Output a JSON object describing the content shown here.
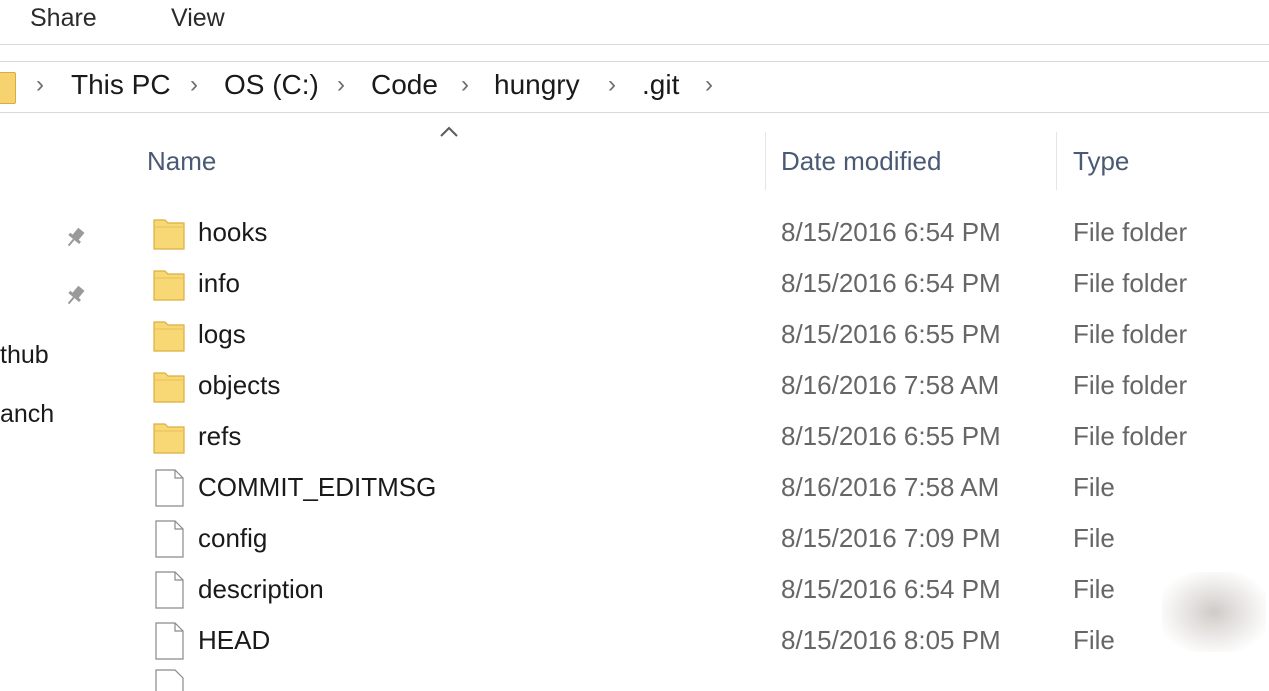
{
  "ribbon": {
    "tabs": [
      {
        "label": "Share"
      },
      {
        "label": "View"
      }
    ]
  },
  "address": {
    "crumbs": [
      "This PC",
      "OS (C:)",
      "Code",
      "hungry",
      ".git"
    ]
  },
  "nav": {
    "items": [
      {
        "label": "thub"
      },
      {
        "label": "anch"
      }
    ]
  },
  "columns": {
    "name": "Name",
    "date": "Date modified",
    "type": "Type"
  },
  "files": [
    {
      "name": "hooks",
      "date": "8/15/2016 6:54 PM",
      "type": "File folder",
      "icon": "folder-icon"
    },
    {
      "name": "info",
      "date": "8/15/2016 6:54 PM",
      "type": "File folder",
      "icon": "folder-icon"
    },
    {
      "name": "logs",
      "date": "8/15/2016 6:55 PM",
      "type": "File folder",
      "icon": "folder-icon"
    },
    {
      "name": "objects",
      "date": "8/16/2016 7:58 AM",
      "type": "File folder",
      "icon": "folder-icon"
    },
    {
      "name": "refs",
      "date": "8/15/2016 6:55 PM",
      "type": "File folder",
      "icon": "folder-icon"
    },
    {
      "name": "COMMIT_EDITMSG",
      "date": "8/16/2016 7:58 AM",
      "type": "File",
      "icon": "file-icon"
    },
    {
      "name": "config",
      "date": "8/15/2016 7:09 PM",
      "type": "File",
      "icon": "file-icon"
    },
    {
      "name": "description",
      "date": "8/15/2016 6:54 PM",
      "type": "File",
      "icon": "file-icon"
    },
    {
      "name": "HEAD",
      "date": "8/15/2016 8:05 PM",
      "type": "File",
      "icon": "file-icon"
    }
  ],
  "colors": {
    "folder_fill": "#f8d775",
    "folder_border": "#dcae3e",
    "header_text": "#4a5a74",
    "secondary_text": "#666666"
  }
}
